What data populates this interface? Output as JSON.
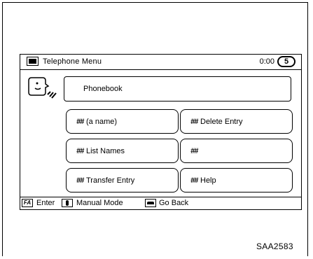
{
  "title_bar": {
    "title": "Telephone Menu",
    "clock": "0:00",
    "back_icon_glyph": "5"
  },
  "phonebook": {
    "label": "Phonebook"
  },
  "buttons": [
    {
      "hash": "##",
      "label": "(a name)"
    },
    {
      "hash": "##",
      "label": "Delete Entry"
    },
    {
      "hash": "##",
      "label": "List Names"
    },
    {
      "hash": "##",
      "label": ""
    },
    {
      "hash": "##",
      "label": "Transfer Entry"
    },
    {
      "hash": "##",
      "label": "Help"
    }
  ],
  "help_bar": {
    "enter_icon_glyph": "FA",
    "enter_label": "Enter",
    "manual_label": "Manual Mode",
    "back_label": "Go Back"
  },
  "figure_code": "SAA2583",
  "icons": [
    "phone-icon",
    "back-icon",
    "voice-icon",
    "enter-icon",
    "manual-mode-icon",
    "go-back-icon"
  ]
}
